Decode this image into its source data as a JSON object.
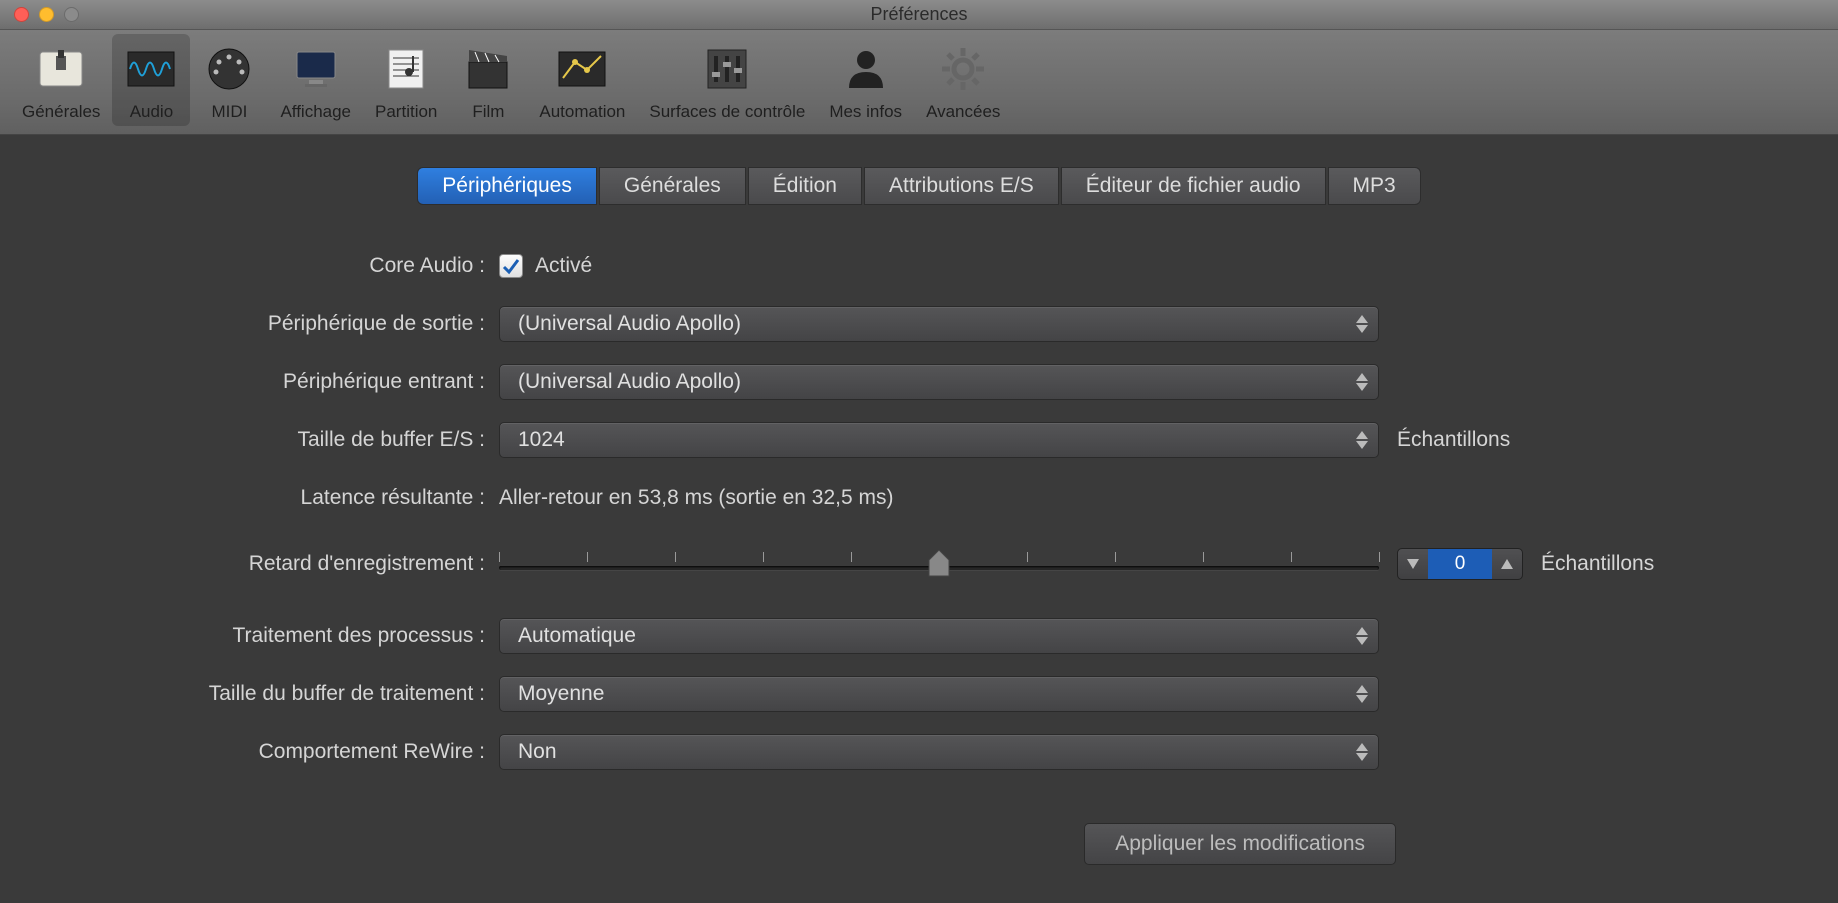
{
  "window": {
    "title": "Préférences"
  },
  "toolbar": [
    {
      "label": "Générales"
    },
    {
      "label": "Audio"
    },
    {
      "label": "MIDI"
    },
    {
      "label": "Affichage"
    },
    {
      "label": "Partition"
    },
    {
      "label": "Film"
    },
    {
      "label": "Automation"
    },
    {
      "label": "Surfaces de contrôle"
    },
    {
      "label": "Mes infos"
    },
    {
      "label": "Avancées"
    }
  ],
  "tabs": [
    {
      "label": "Périphériques"
    },
    {
      "label": "Générales"
    },
    {
      "label": "Édition"
    },
    {
      "label": "Attributions E/S"
    },
    {
      "label": "Éditeur de fichier audio"
    },
    {
      "label": "MP3"
    }
  ],
  "form": {
    "core_audio_label": "Core Audio :",
    "core_audio_checkbox_text": "Activé",
    "output_label": "Périphérique de sortie :",
    "output_value": "(Universal Audio Apollo)",
    "input_label": "Périphérique entrant :",
    "input_value": "(Universal Audio Apollo)",
    "buffer_label": "Taille de buffer E/S :",
    "buffer_value": "1024",
    "buffer_unit": "Échantillons",
    "latency_label": "Latence résultante :",
    "latency_value": "Aller-retour en 53,8 ms (sortie en 32,5 ms)",
    "record_delay_label": "Retard d'enregistrement :",
    "record_delay_value": "0",
    "record_delay_unit": "Échantillons",
    "threads_label": "Traitement des processus :",
    "threads_value": "Automatique",
    "proc_buffer_label": "Taille du buffer de traitement :",
    "proc_buffer_value": "Moyenne",
    "rewire_label": "Comportement ReWire :",
    "rewire_value": "Non",
    "apply_label": "Appliquer les modifications"
  }
}
